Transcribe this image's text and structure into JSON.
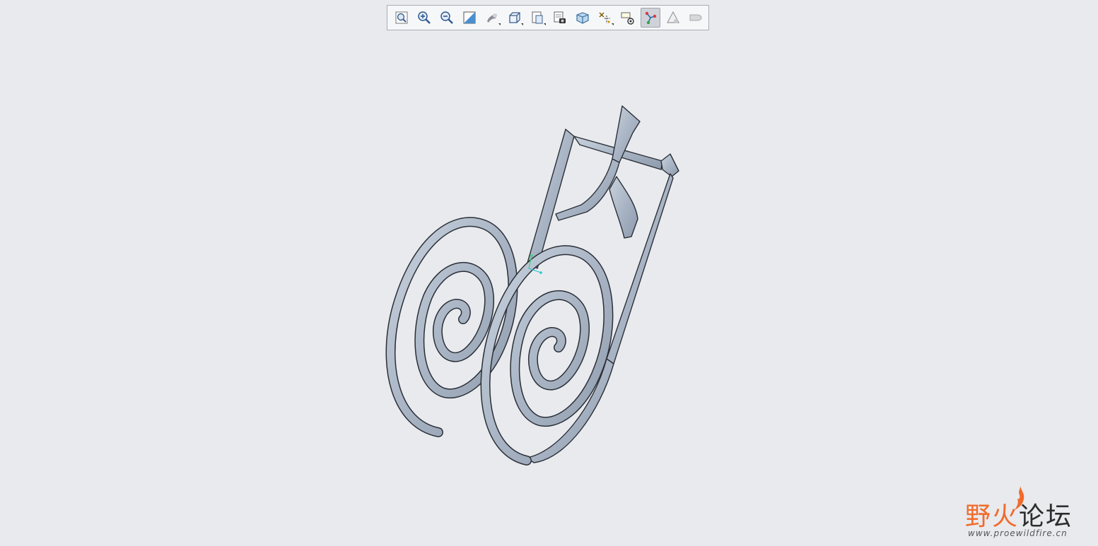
{
  "toolbar": {
    "buttons": [
      {
        "name": "refit-icon",
        "active": false,
        "dropdown": false
      },
      {
        "name": "zoom-in-icon",
        "active": false,
        "dropdown": false
      },
      {
        "name": "zoom-out-icon",
        "active": false,
        "dropdown": false
      },
      {
        "name": "repaint-icon",
        "active": false,
        "dropdown": false
      },
      {
        "name": "display-style-icon",
        "active": false,
        "dropdown": true
      },
      {
        "name": "saved-orientations-icon",
        "active": false,
        "dropdown": true
      },
      {
        "name": "named-views-icon",
        "active": false,
        "dropdown": true
      },
      {
        "name": "view-manager-icon",
        "active": false,
        "dropdown": false
      },
      {
        "name": "perspective-view-icon",
        "active": false,
        "dropdown": false
      },
      {
        "name": "datum-display-icon",
        "active": false,
        "dropdown": true
      },
      {
        "name": "annotation-display-icon",
        "active": false,
        "dropdown": false
      },
      {
        "name": "spin-center-icon",
        "active": true,
        "dropdown": false
      },
      {
        "name": "show-triangle-icon",
        "active": false,
        "dropdown": false
      },
      {
        "name": "shading-icon",
        "active": false,
        "dropdown": false
      }
    ]
  },
  "colors": {
    "background": "#e8eaee",
    "model_face": "#b7c2d0",
    "model_edge": "#2b2f36",
    "logo_orange": "#f26a2a"
  },
  "logo": {
    "part1": "野火",
    "part2": "论坛",
    "url": "www.proewildfire.cn"
  }
}
